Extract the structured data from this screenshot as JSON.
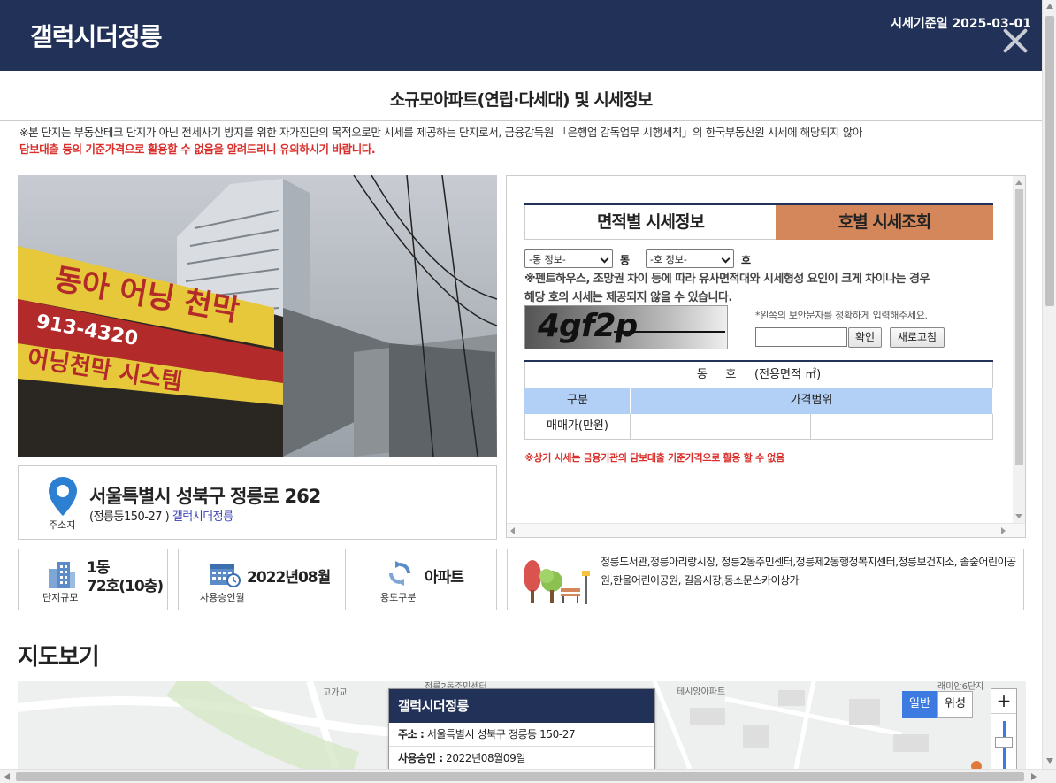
{
  "header": {
    "title": "갤럭시더정릉",
    "base_date": "시세기준일 2025-03-01"
  },
  "subtitle": "소규모아파트(연립·다세대) 및 시세정보",
  "notice": {
    "line1": "※본 단지는 부동산테크 단지가 아닌 전세사기 방지를 위한 자가진단의 목적으로만 시세를 제공하는 단지로서, 금융감독원 「은행업 감독업무 시행세칙」의 한국부동산원 시세에 해당되지 않아",
    "line2": "담보대출 등의 기준가격으로 활용할 수 없음을 알려드리니 유의하시기 바랍니다."
  },
  "address": {
    "label": "주소지",
    "road": "서울특별시 성북구 정릉로 262",
    "jibun_prefix": "(정릉동150-27 ) ",
    "complex_name": "갤럭시더정릉"
  },
  "stats": {
    "scale_value_1": "1동",
    "scale_value_2": "72호(10층)",
    "scale_label": "단지규모",
    "approval_value": "2022년08월",
    "approval_label": "사용승인월",
    "use_value": "아파트",
    "use_label": "용도구분"
  },
  "facilities": "정릉도서관,정릉아리랑시장, 정릉2동주민센터,정릉제2동행정복지센터,정릉보건지소, 솔숲어린이공원,한울어린이공원, 길음시장,동소문스카이상가",
  "panel": {
    "tab_area": "면적별 시세정보",
    "tab_unit": "호별 시세조회",
    "dong_select": "-동 정보-",
    "dong_unit": "동",
    "ho_select": "-호 정보-",
    "ho_unit": "호",
    "warn_line1": "※펜트하우스, 조망권 차이 등에 따라 유사면적대와 시세형성 요인이 크게 차이나는 경우",
    "warn_line2": "해당 호의 시세는 제공되지 않을 수 있습니다.",
    "captcha_text": "4gf2p",
    "captcha_hint": "*왼쪽의 보안문자를 정확하게 입력해주세요.",
    "captcha_input_value": "",
    "confirm_button": "확인",
    "refresh_button": "새로고침",
    "table_header": "동     호     (전용면적 ㎡)",
    "col_category": "구분",
    "col_range": "가격범위",
    "row_label": "매매가(만원)",
    "footnote": "※상기 시세는 금융기관의 담보대출 기준가격으로 활용 할 수 없음",
    "tab_active_color": "#d4875a"
  },
  "map": {
    "title": "지도보기",
    "popup_title": "갤럭시더정릉",
    "popup_addr_label": "주소 :",
    "popup_addr": "서울특별시 성북구 정릉동 150-27",
    "popup_approval_label": "사용승인 :",
    "popup_approval": "2022년08월09일",
    "type_normal": "일반",
    "type_satellite": "위성",
    "zoom_in": "+",
    "label_a": "정릉2동주민센터",
    "label_b": "테시앙아파트",
    "label_c": "래미안6단지",
    "label_d": "고가교"
  },
  "colors": {
    "navy": "#213158",
    "red": "#d9302c",
    "table_head": "#b2d0f5"
  }
}
